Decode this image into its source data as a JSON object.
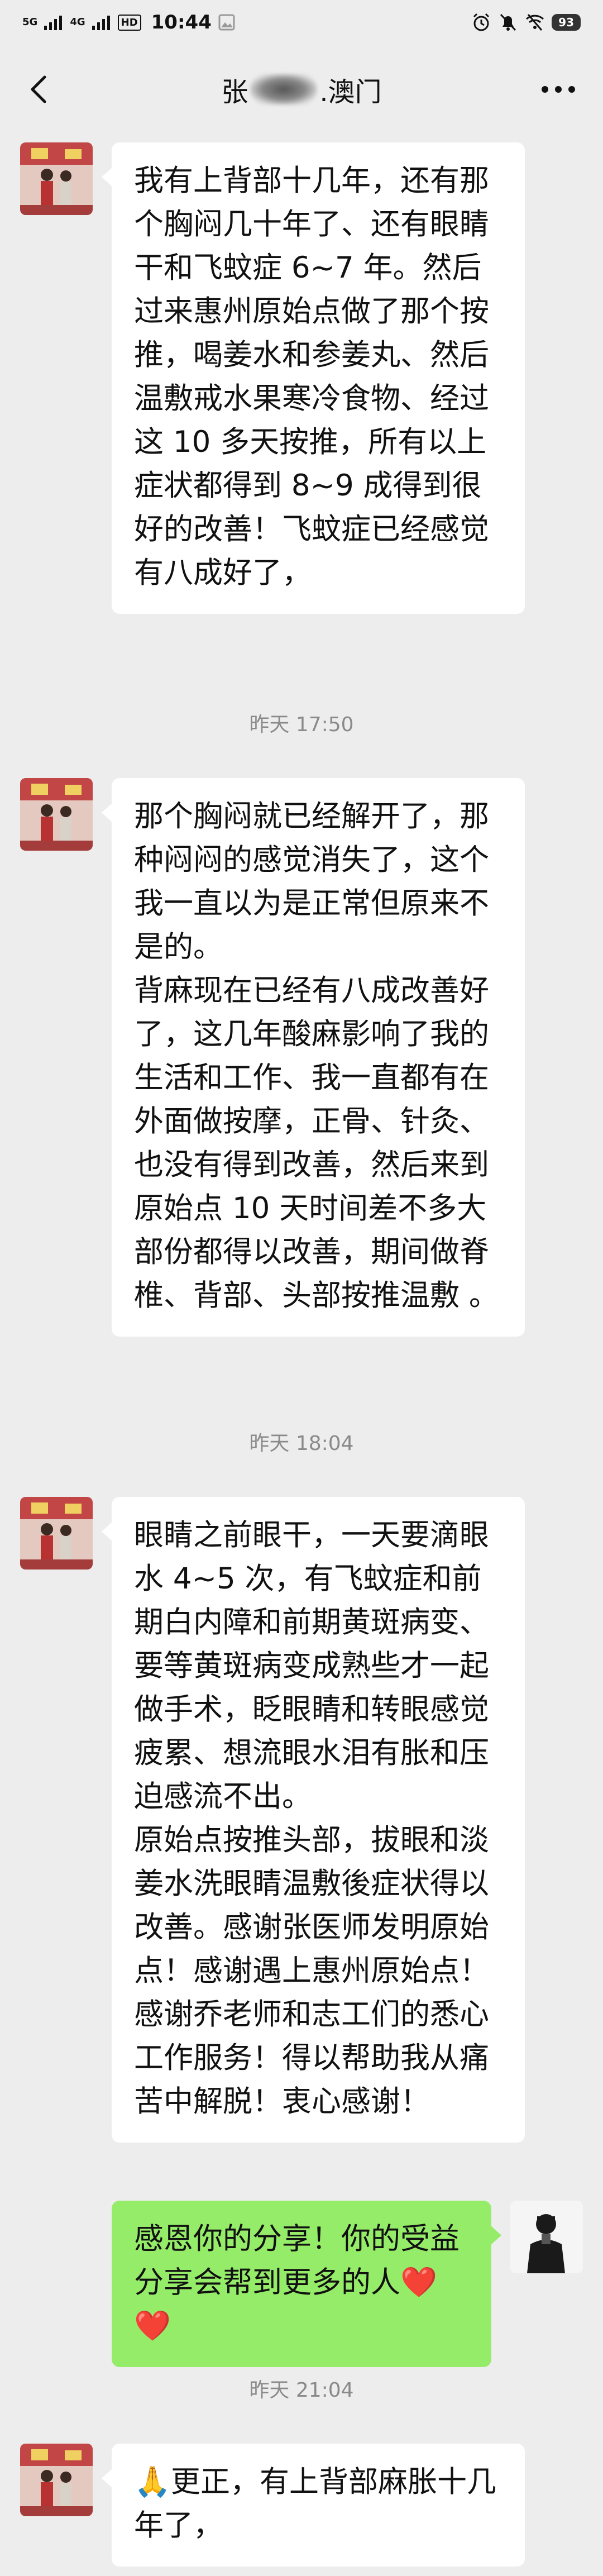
{
  "status_bar": {
    "signal_1_label": "5G",
    "signal_2_label": "4G",
    "hd_label": "HD",
    "time": "10:44",
    "battery": "93"
  },
  "header": {
    "title_prefix": "张",
    "title_suffix": ".澳门"
  },
  "colors": {
    "background": "#ededed",
    "bubble_incoming": "#ffffff",
    "bubble_outgoing": "#95ec69",
    "timestamp_text": "#8a8a8a"
  },
  "messages": [
    {
      "sender": "incoming",
      "paragraphs": [
        "我有上背部十几年，还有那个胸闷几十年了、还有眼睛干和飞蚊症 6~7 年。然后过来惠州原始点做了那个按推，喝姜水和参姜丸、然后温敷戒水果寒冷食物、经过这 10 多天按推，所有以上症状都得到 8~9 成得到很好的改善！飞蚊症已经感觉有八成好了，"
      ]
    },
    {
      "timestamp": "昨天 17:50"
    },
    {
      "sender": "incoming",
      "paragraphs": [
        "那个胸闷就已经解开了，那种闷闷的感觉消失了，这个我一直以为是正常但原来不是的。",
        "背麻现在已经有八成改善好了，这几年酸麻影响了我的生活和工作、我一直都有在外面做按摩，正骨、针灸、也没有得到改善，然后来到原始点 10 天时间差不多大部份都得以改善，期间做脊椎、背部、头部按推温敷 。"
      ]
    },
    {
      "timestamp": "昨天 18:04"
    },
    {
      "sender": "incoming",
      "paragraphs": [
        "眼睛之前眼干，一天要滴眼水 4~5 次，有飞蚊症和前期白内障和前期黄斑病变、要等黄斑病变成熟些才一起做手术，眨眼睛和转眼感觉疲累、想流眼水泪有胀和压迫感流不出。",
        "原始点按推头部，拔眼和淡姜水洗眼睛温敷後症状得以改善。感谢张医师发明原始点！感谢遇上惠州原始点！感谢乔老师和志工们的悉心工作服务！得以帮助我从痛苦中解脱！衷心感谢！"
      ]
    },
    {
      "sender": "outgoing",
      "paragraphs": [
        "感恩你的分享！你的受益分享会帮到更多的人❤️❤️"
      ]
    },
    {
      "timestamp": "昨天 21:04"
    },
    {
      "sender": "incoming",
      "paragraphs": [
        "🙏更正，有上背部麻胀十几年了，"
      ]
    }
  ]
}
